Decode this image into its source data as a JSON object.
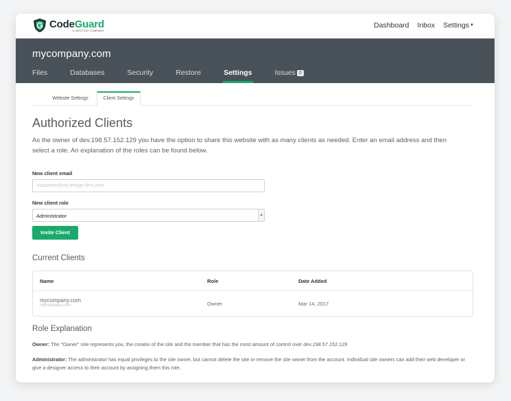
{
  "brand": {
    "name_prefix": "Code",
    "name_suffix": "Guard",
    "tagline": "A SECTIGO COMPANY"
  },
  "topnav": {
    "dashboard": "Dashboard",
    "inbox": "Inbox",
    "settings": "Settings"
  },
  "site": {
    "name": "mycompany.com"
  },
  "tabs": {
    "files": "Files",
    "databases": "Databases",
    "security": "Security",
    "restore": "Restore",
    "settings": "Settings",
    "issues": "Issues",
    "issues_count": "0"
  },
  "subtabs": {
    "website": "Website Settings",
    "client": "Client Settings"
  },
  "page": {
    "title": "Authorized Clients",
    "intro": "As the owner of dev.198.57.152.129 you have the option to share this website with as many clients as needed. Enter an email address and then select a role. An explanation of the roles can be found below."
  },
  "form": {
    "email_label": "New client email",
    "email_placeholder": "customer@my-design-firm.com",
    "role_label": "New client role",
    "role_value": "Administrator",
    "invite_button": "Invite Client"
  },
  "clients": {
    "heading": "Current Clients",
    "columns": {
      "name": "Name",
      "role": "Role",
      "date": "Date Added"
    },
    "rows": [
      {
        "name": "mycompany.com",
        "sub": "mycompany.com",
        "role": "Owner",
        "date": "Mar 14, 2017"
      }
    ]
  },
  "roles": {
    "heading": "Role Explanation",
    "owner_label": "Owner:",
    "owner_text": "The \"Owner\" role represents you, the creator of the site and the member that has the most amount of control over ",
    "owner_site": "dev.198.57.152.129",
    "admin_label": "Administrator:",
    "admin_text": "The administrator has equal privileges to the site owner, but cannot delete the site or remove the site owner from the account. Individual site owners can add their web developer or give a designer access to their account by assigning them this role."
  },
  "colors": {
    "accent": "#1aaa6c",
    "header_bg": "#4a5259"
  }
}
